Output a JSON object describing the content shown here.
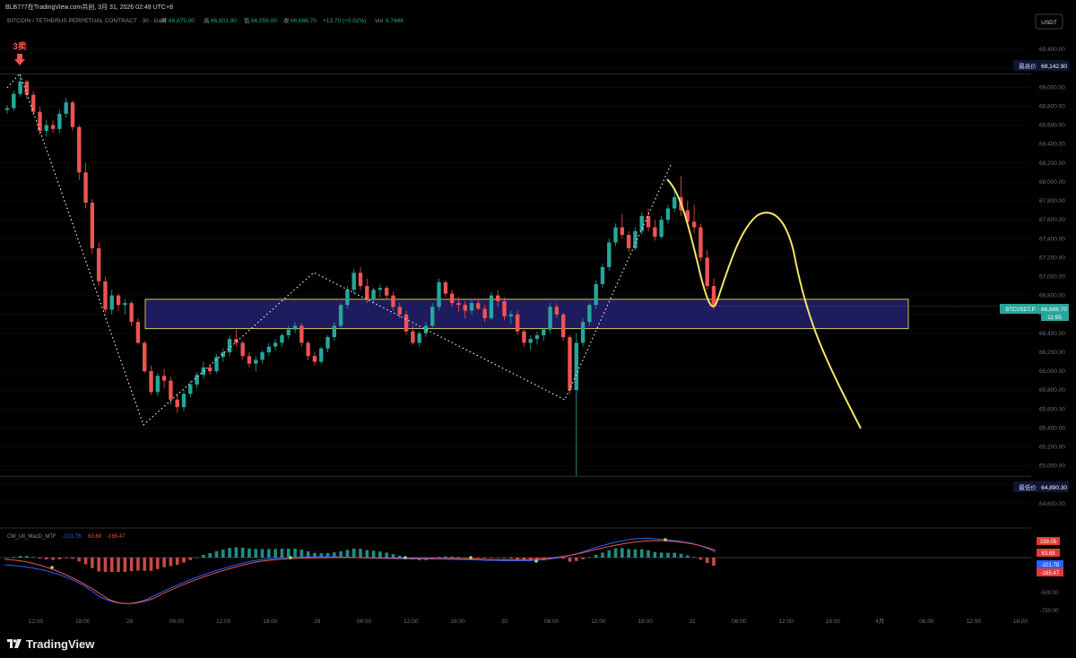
{
  "header": {
    "watermark": "BLB777在TradingView.com共创, 3月 31, 2026 02:48 UTC+8",
    "symbol_line": "BITCOIN / TETHERUS PERPETUAL CONTRACT · 30 · Gate",
    "ohlc": {
      "o": "66,675.00",
      "h": "66,801.90",
      "l": "66,556.00",
      "c": "66,686.70",
      "chg": "+13.70 (+0.02%)"
    },
    "volume": "6.744K"
  },
  "currency_button": "USDT",
  "signal_label": "3卖",
  "price_axis": {
    "ticks": [
      "69,400.00",
      "69,200.00",
      "69,000.00",
      "68,800.00",
      "68,600.00",
      "68,400.00",
      "68,200.00",
      "68,000.00",
      "67,800.00",
      "67,600.00",
      "67,400.00",
      "67,200.00",
      "67,000.00",
      "66,800.00",
      "66,600.00",
      "66,400.00",
      "66,200.00",
      "66,000.00",
      "65,800.00",
      "65,600.00",
      "65,400.00",
      "65,200.00",
      "65,000.00",
      "64,800.00",
      "64,600.00"
    ],
    "high_label": "最高价",
    "high_value": "69,142.90",
    "low_label": "最低价",
    "low_value": "64,890.30",
    "current_symbol": "BTCUSDT.P",
    "current_value": "66,686.70",
    "countdown": "11:55"
  },
  "time_axis": [
    "12:00",
    "18:00",
    "28",
    "06:00",
    "12:00",
    "18:00",
    "29",
    "06:00",
    "12:00",
    "18:00",
    "30",
    "06:00",
    "12:00",
    "18:00",
    "31",
    "06:00",
    "12:00",
    "18:00",
    "4月",
    "06:00",
    "12:00",
    "18:00"
  ],
  "macd": {
    "label": "CM_Ult_MacD_MTF",
    "v1": "-101.78",
    "v2": "63.69",
    "v3": "-165.47",
    "axis_ticks": [
      "-500.00",
      "-750.00"
    ],
    "badges": [
      "239.05",
      "63.69",
      "-101.78",
      "-165.47"
    ]
  },
  "footer": {
    "brand": "TradingView"
  },
  "colors": {
    "up": "#26a69a",
    "down": "#ef5350",
    "zone": "#1e1b5e",
    "zone_border": "#d4c35a",
    "projection": "#f5e663",
    "accent_blue": "#2962ff"
  },
  "chart_data": {
    "type": "candlestick",
    "title": "BITCOIN / TETHERUS PERPETUAL CONTRACT · 30 · Gate",
    "ylim": [
      64400,
      69600
    ],
    "interval": "30m",
    "ohlc": [
      [
        68760,
        68810,
        68720,
        68780
      ],
      [
        68780,
        68960,
        68750,
        68930
      ],
      [
        68930,
        69140,
        68900,
        69060
      ],
      [
        69060,
        69080,
        68880,
        68920
      ],
      [
        68920,
        68960,
        68700,
        68740
      ],
      [
        68740,
        68800,
        68500,
        68540
      ],
      [
        68540,
        68660,
        68480,
        68600
      ],
      [
        68600,
        68650,
        68520,
        68560
      ],
      [
        68560,
        68760,
        68520,
        68720
      ],
      [
        68720,
        68890,
        68680,
        68840
      ],
      [
        68840,
        68860,
        68540,
        68580
      ],
      [
        68580,
        68600,
        68020,
        68100
      ],
      [
        68100,
        68200,
        67720,
        67780
      ],
      [
        67780,
        67820,
        67240,
        67300
      ],
      [
        67300,
        67360,
        66900,
        66950
      ],
      [
        66950,
        67000,
        66620,
        66650
      ],
      [
        66650,
        66860,
        66600,
        66800
      ],
      [
        66800,
        66820,
        66640,
        66700
      ],
      [
        66700,
        66760,
        66600,
        66720
      ],
      [
        66720,
        66740,
        66480,
        66520
      ],
      [
        66520,
        66560,
        66280,
        66300
      ],
      [
        66300,
        66320,
        65980,
        66000
      ],
      [
        66000,
        66060,
        65750,
        65780
      ],
      [
        65780,
        65980,
        65740,
        65950
      ],
      [
        65950,
        66020,
        65820,
        65900
      ],
      [
        65900,
        65940,
        65650,
        65700
      ],
      [
        65700,
        65760,
        65560,
        65620
      ],
      [
        65620,
        65800,
        65580,
        65760
      ],
      [
        65760,
        65900,
        65720,
        65860
      ],
      [
        65860,
        65990,
        65820,
        65960
      ],
      [
        65960,
        66100,
        65920,
        66040
      ],
      [
        66040,
        66080,
        65960,
        66000
      ],
      [
        66000,
        66180,
        65980,
        66150
      ],
      [
        66150,
        66240,
        66100,
        66200
      ],
      [
        66200,
        66380,
        66160,
        66340
      ],
      [
        66340,
        66440,
        66260,
        66300
      ],
      [
        66300,
        66320,
        66120,
        66160
      ],
      [
        66160,
        66200,
        66040,
        66080
      ],
      [
        66080,
        66160,
        66000,
        66120
      ],
      [
        66120,
        66220,
        66080,
        66200
      ],
      [
        66200,
        66300,
        66160,
        66260
      ],
      [
        66260,
        66340,
        66220,
        66300
      ],
      [
        66300,
        66400,
        66260,
        66380
      ],
      [
        66380,
        66480,
        66340,
        66440
      ],
      [
        66440,
        66520,
        66400,
        66480
      ],
      [
        66480,
        66510,
        66260,
        66300
      ],
      [
        66300,
        66320,
        66120,
        66160
      ],
      [
        66160,
        66200,
        66060,
        66100
      ],
      [
        66100,
        66260,
        66080,
        66240
      ],
      [
        66240,
        66380,
        66200,
        66360
      ],
      [
        66360,
        66520,
        66320,
        66480
      ],
      [
        66480,
        66720,
        66440,
        66700
      ],
      [
        66700,
        66900,
        66660,
        66860
      ],
      [
        66860,
        67080,
        66820,
        67040
      ],
      [
        67040,
        67100,
        66860,
        66900
      ],
      [
        66900,
        66980,
        66720,
        66760
      ],
      [
        66760,
        66880,
        66720,
        66860
      ],
      [
        66860,
        66920,
        66780,
        66880
      ],
      [
        66880,
        66900,
        66760,
        66800
      ],
      [
        66800,
        66840,
        66640,
        66680
      ],
      [
        66680,
        66720,
        66560,
        66600
      ],
      [
        66600,
        66640,
        66380,
        66420
      ],
      [
        66420,
        66480,
        66280,
        66300
      ],
      [
        66300,
        66420,
        66260,
        66400
      ],
      [
        66400,
        66520,
        66360,
        66480
      ],
      [
        66480,
        66720,
        66460,
        66680
      ],
      [
        66680,
        66980,
        66640,
        66940
      ],
      [
        66940,
        66960,
        66780,
        66820
      ],
      [
        66820,
        66860,
        66680,
        66720
      ],
      [
        66720,
        66780,
        66620,
        66700
      ],
      [
        66700,
        66740,
        66560,
        66640
      ],
      [
        66640,
        66760,
        66600,
        66720
      ],
      [
        66720,
        66760,
        66640,
        66660
      ],
      [
        66660,
        66700,
        66520,
        66560
      ],
      [
        66560,
        66840,
        66540,
        66800
      ],
      [
        66800,
        66860,
        66680,
        66740
      ],
      [
        66740,
        66780,
        66540,
        66580
      ],
      [
        66580,
        66640,
        66500,
        66600
      ],
      [
        66600,
        66640,
        66380,
        66420
      ],
      [
        66420,
        66460,
        66260,
        66300
      ],
      [
        66300,
        66380,
        66220,
        66340
      ],
      [
        66340,
        66420,
        66280,
        66380
      ],
      [
        66380,
        66460,
        66320,
        66440
      ],
      [
        66440,
        66720,
        66400,
        66680
      ],
      [
        66680,
        66720,
        66560,
        66600
      ],
      [
        66600,
        66620,
        66320,
        66360
      ],
      [
        66360,
        66380,
        65760,
        65800
      ],
      [
        65800,
        66400,
        64890,
        66300
      ],
      [
        66300,
        66560,
        66260,
        66520
      ],
      [
        66520,
        66720,
        66480,
        66700
      ],
      [
        66700,
        66960,
        66660,
        66920
      ],
      [
        66920,
        67140,
        66880,
        67100
      ],
      [
        67100,
        67400,
        67060,
        67360
      ],
      [
        67360,
        67560,
        67320,
        67520
      ],
      [
        67520,
        67660,
        67400,
        67440
      ],
      [
        67440,
        67480,
        67260,
        67300
      ],
      [
        67300,
        67520,
        67280,
        67480
      ],
      [
        67480,
        67680,
        67440,
        67640
      ],
      [
        67640,
        67720,
        67480,
        67520
      ],
      [
        67520,
        67600,
        67380,
        67420
      ],
      [
        67420,
        67640,
        67400,
        67600
      ],
      [
        67600,
        67760,
        67560,
        67720
      ],
      [
        67720,
        67900,
        67680,
        67840
      ],
      [
        67840,
        68060,
        67640,
        67700
      ],
      [
        67700,
        67800,
        67540,
        67580
      ],
      [
        67580,
        67760,
        67460,
        67520
      ],
      [
        67520,
        67560,
        67160,
        67200
      ],
      [
        67200,
        67280,
        66860,
        66900
      ],
      [
        66900,
        66980,
        66650,
        66686
      ]
    ],
    "zone": [
      66450,
      66760
    ],
    "high": 69142.9,
    "low": 64890.3,
    "last": 66686.7
  }
}
